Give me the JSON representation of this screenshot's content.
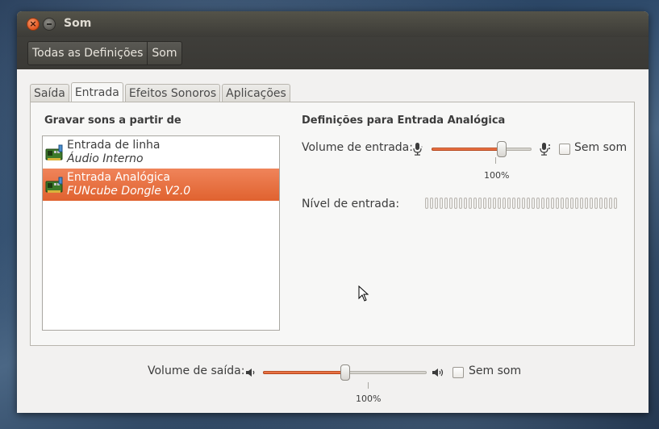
{
  "window": {
    "title": "Som"
  },
  "titlebar": {
    "close_glyph": "×",
    "icons": [
      "close-icon",
      "minimize-icon"
    ]
  },
  "breadcrumb": {
    "items": [
      "Todas as Definições",
      "Som"
    ]
  },
  "tabs": [
    {
      "label": "Saída",
      "active": false
    },
    {
      "label": "Entrada",
      "active": true
    },
    {
      "label": "Efeitos Sonoros",
      "active": false
    },
    {
      "label": "Aplicações",
      "active": false
    }
  ],
  "input_tab": {
    "record_from_heading": "Gravar sons a partir de",
    "devices": [
      {
        "name": "Entrada de linha",
        "description": "Áudio Interno",
        "selected": false,
        "icon": "sound-card-icon"
      },
      {
        "name": "Entrada Analógica",
        "description": "FUNcube Dongle V2.0",
        "selected": true,
        "icon": "sound-card-icon"
      }
    ],
    "settings_heading": "Definições para Entrada Analógica",
    "input_volume_label": "Volume de entrada:",
    "input_volume_value": 0.7,
    "input_volume_mark": "100%",
    "input_mute_label": "Sem som",
    "input_mute_checked": false,
    "input_level_label": "Nível de entrada:",
    "input_level_value": 0,
    "input_level_segments": 40
  },
  "output": {
    "volume_label": "Volume de saída:",
    "volume_value": 0.5,
    "volume_mark": "100%",
    "mute_label": "Sem som",
    "mute_checked": false
  },
  "colors": {
    "accent": "#e0622f",
    "titlebar": "#3c3b37",
    "window_bg": "#f2f1f0"
  }
}
